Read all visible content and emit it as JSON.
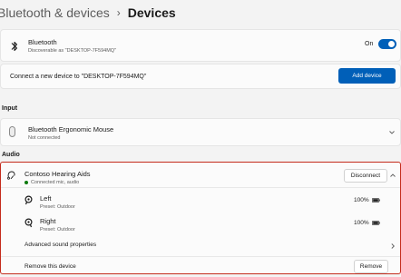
{
  "breadcrumb": {
    "parent": "Bluetooth & devices",
    "separator": "›",
    "current": "Devices"
  },
  "bluetooth": {
    "title": "Bluetooth",
    "subtitle": "Discoverable as \"DESKTOP-7F594MQ\"",
    "toggle_label": "On",
    "toggle_on": true,
    "icon": "bluetooth-icon"
  },
  "add_device": {
    "text": "Connect a new device to \"DESKTOP-7F594MQ\"",
    "button_label": "Add device"
  },
  "sections": {
    "input": "Input",
    "audio": "Audio"
  },
  "mouse": {
    "title": "Bluetooth Ergonomic Mouse",
    "status": "Not connected",
    "icon": "mouse-icon"
  },
  "hearing_aids": {
    "title": "Contoso Hearing Aids",
    "status": "Connected mic, audio",
    "disconnect_label": "Disconnect",
    "left": {
      "label": "Left",
      "preset": "Preset: Outdoor",
      "battery": "100%"
    },
    "right": {
      "label": "Right",
      "preset": "Preset: Outdoor",
      "battery": "100%"
    },
    "advanced_label": "Advanced sound properties",
    "remove_text": "Remove this device",
    "remove_button": "Remove"
  },
  "colors": {
    "accent": "#005fb8",
    "highlight_border": "#c42b1c",
    "connected": "#0f7b0f"
  }
}
